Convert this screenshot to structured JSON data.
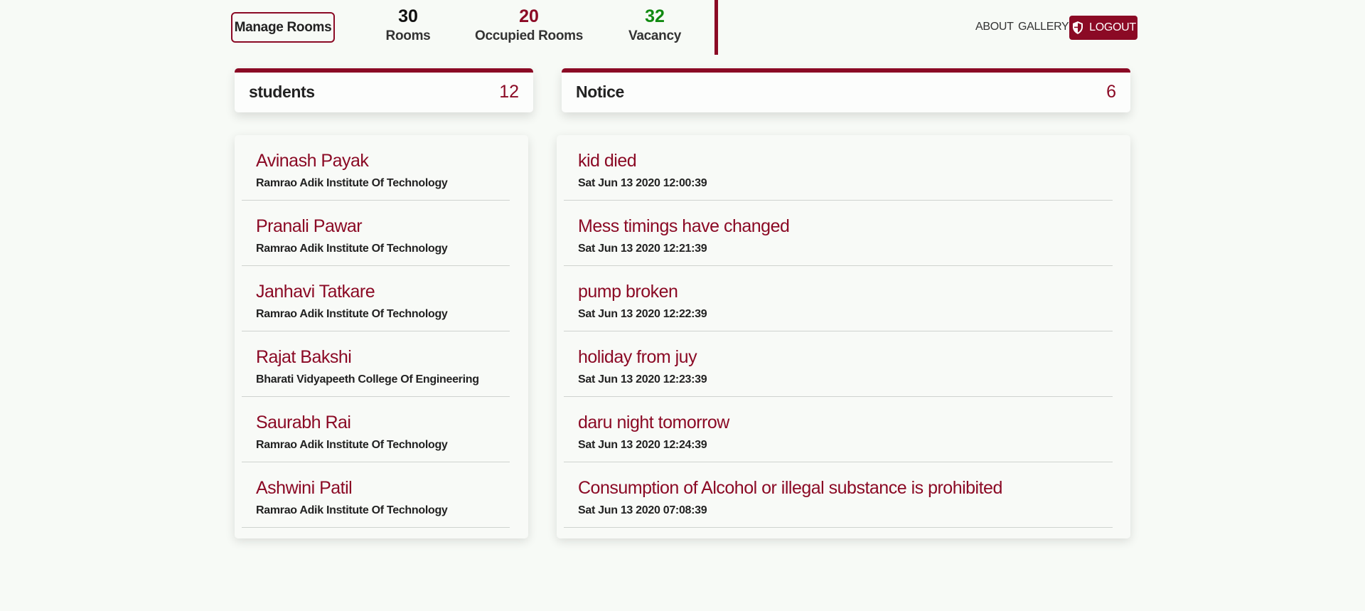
{
  "topbar": {
    "manage_rooms_label": "Manage Rooms",
    "stats": {
      "rooms": {
        "value": "30",
        "label": "Rooms"
      },
      "occupied": {
        "value": "20",
        "label": "Occupied Rooms"
      },
      "vacancy": {
        "value": "32",
        "label": "Vacancy"
      }
    },
    "nav": {
      "about": "ABOUT",
      "gallery": "GALLERY",
      "logout": "LOGOUT",
      "logout_icon": "shield-icon"
    }
  },
  "students": {
    "title": "students",
    "count": "12",
    "items": [
      {
        "name": "Avinash Payak",
        "college": "Ramrao Adik Institute Of Technology"
      },
      {
        "name": "Pranali Pawar",
        "college": "Ramrao Adik Institute Of Technology"
      },
      {
        "name": "Janhavi Tatkare",
        "college": "Ramrao Adik Institute Of Technology"
      },
      {
        "name": "Rajat Bakshi",
        "college": "Bharati Vidyapeeth College Of Engineering"
      },
      {
        "name": "Saurabh Rai",
        "college": "Ramrao Adik Institute Of Technology"
      },
      {
        "name": "Ashwini Patil",
        "college": "Ramrao Adik Institute Of Technology"
      }
    ]
  },
  "notice": {
    "title": "Notice",
    "count": "6",
    "items": [
      {
        "text": "kid died",
        "date": "Sat Jun 13 2020 12:00:39"
      },
      {
        "text": "Mess timings have changed",
        "date": "Sat Jun 13 2020 12:21:39"
      },
      {
        "text": "pump broken",
        "date": "Sat Jun 13 2020 12:22:39"
      },
      {
        "text": "holiday from juy",
        "date": "Sat Jun 13 2020 12:23:39"
      },
      {
        "text": "daru night tomorrow",
        "date": "Sat Jun 13 2020 12:24:39"
      },
      {
        "text": "Consumption of Alcohol or illegal substance is prohibited",
        "date": "Sat Jun 13 2020 07:08:39"
      }
    ]
  },
  "colors": {
    "accent": "#8b0a25",
    "vacancy": "#118a11",
    "background": "#f7faf6"
  }
}
